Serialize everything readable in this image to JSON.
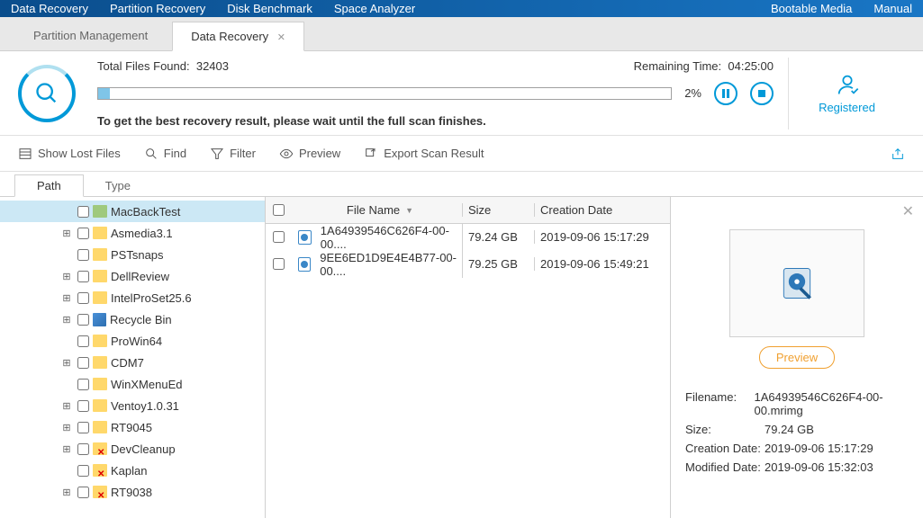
{
  "topMenu": {
    "left": [
      "Data Recovery",
      "Partition Recovery",
      "Disk Benchmark",
      "Space Analyzer"
    ],
    "right": [
      "Bootable Media",
      "Manual"
    ]
  },
  "tabs": {
    "inactive": "Partition Management",
    "active": "Data Recovery"
  },
  "scan": {
    "totalLabel": "Total Files Found:",
    "totalValue": "32403",
    "remainingLabel": "Remaining Time:",
    "remainingValue": "04:25:00",
    "pct": "2%",
    "hint": "To get the best recovery result, please wait until the full scan finishes.",
    "registered": "Registered"
  },
  "toolbar": {
    "showLost": "Show Lost Files",
    "find": "Find",
    "filter": "Filter",
    "preview": "Preview",
    "export": "Export Scan Result"
  },
  "subTabs": {
    "path": "Path",
    "type": "Type"
  },
  "tree": [
    {
      "name": "MacBackTest",
      "expander": "",
      "selected": true,
      "green": true
    },
    {
      "name": "Asmedia3.1",
      "expander": "⊞"
    },
    {
      "name": "PSTsnaps",
      "expander": ""
    },
    {
      "name": "DellReview",
      "expander": "⊞"
    },
    {
      "name": "IntelProSet25.6",
      "expander": "⊞"
    },
    {
      "name": "Recycle Bin",
      "expander": "⊞",
      "recycle": true
    },
    {
      "name": "ProWin64",
      "expander": ""
    },
    {
      "name": "CDM7",
      "expander": "⊞"
    },
    {
      "name": "WinXMenuEd",
      "expander": ""
    },
    {
      "name": "Ventoy1.0.31",
      "expander": "⊞"
    },
    {
      "name": "RT9045",
      "expander": "⊞"
    },
    {
      "name": "DevCleanup",
      "expander": "⊞",
      "deleted": true
    },
    {
      "name": "Kaplan",
      "expander": "",
      "deleted": true
    },
    {
      "name": "RT9038",
      "expander": "⊞",
      "deleted": true
    }
  ],
  "fileHeader": {
    "name": "File Name",
    "size": "Size",
    "date": "Creation Date"
  },
  "files": [
    {
      "name": "1A64939546C626F4-00-00....",
      "size": "79.24 GB",
      "date": "2019-09-06 15:17:29"
    },
    {
      "name": "9EE6ED1D9E4E4B77-00-00....",
      "size": "79.25 GB",
      "date": "2019-09-06 15:49:21"
    }
  ],
  "details": {
    "previewBtn": "Preview",
    "labels": {
      "filename": "Filename:",
      "size": "Size:",
      "created": "Creation Date:",
      "modified": "Modified Date:"
    },
    "filename": "1A64939546C626F4-00-00.mrimg",
    "size": "79.24 GB",
    "created": "2019-09-06 15:17:29",
    "modified": "2019-09-06 15:32:03"
  }
}
